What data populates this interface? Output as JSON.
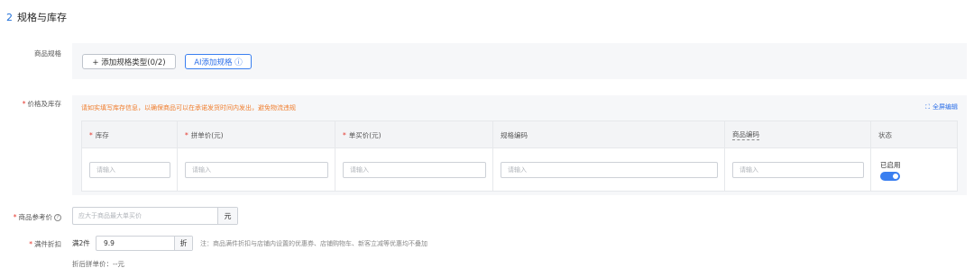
{
  "section": {
    "number": "2",
    "title": "规格与库存"
  },
  "spec": {
    "label": "商品规格",
    "add_type_button": "+ 添加规格类型(0/2)",
    "ai_button": "AI添加规格 ⓘ"
  },
  "stock": {
    "label": "价格及库存",
    "warning": "请如实填写库存信息，以确保商品可以在承诺发货时间内发出，避免物流违规",
    "fullscreen": "全屏编辑",
    "columns": [
      {
        "label": "库存",
        "required": true
      },
      {
        "label": "拼单价(元)",
        "required": true
      },
      {
        "label": "单买价(元)",
        "required": true
      },
      {
        "label": "规格编码",
        "required": false
      },
      {
        "label": "商品编码",
        "required": false
      },
      {
        "label": "状态",
        "required": false
      }
    ],
    "placeholder": "请输入",
    "status_text": "已启用",
    "status_enabled": true
  },
  "reference_price": {
    "label": "商品参考价",
    "placeholder": "应大于商品最大单买价",
    "unit": "元"
  },
  "discount": {
    "label": "满件折扣",
    "prefix": "满2件",
    "value": "9.9",
    "unit": "折",
    "note": "注：商品满件折扣与店铺内设置的优惠券、店铺购物车、新客立减等优惠均不叠加",
    "after_price": "折后拼单价：--元"
  },
  "colors": {
    "accent": "#2c6fe8",
    "required": "#e5362c",
    "warning": "#f07e2e"
  }
}
